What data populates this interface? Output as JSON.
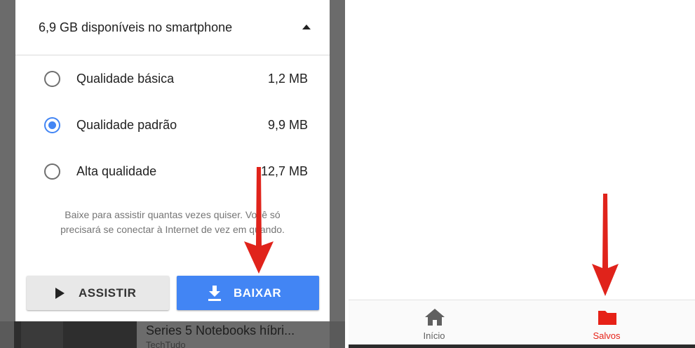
{
  "dialog": {
    "storage_text": "6,9 GB disponíveis no smartphone",
    "options": [
      {
        "label": "Qualidade básica",
        "size": "1,2 MB",
        "selected": false
      },
      {
        "label": "Qualidade padrão",
        "size": "9,9 MB",
        "selected": true
      },
      {
        "label": "Alta qualidade",
        "size": "12,7 MB",
        "selected": false
      }
    ],
    "description": "Baixe para assistir quantas vezes quiser. Você só precisará se conectar à Internet de vez em quando.",
    "assistir_label": "ASSISTIR",
    "baixar_label": "BAIXAR"
  },
  "background": {
    "video_title": "Series 5 Notebooks híbri...",
    "video_channel": "TechTudo"
  },
  "bottom_nav": {
    "items": [
      {
        "label": "Início",
        "icon": "home-icon",
        "active": false
      },
      {
        "label": "Salvos",
        "icon": "folder-icon",
        "active": true
      }
    ]
  },
  "colors": {
    "accent_blue": "#4285f4",
    "active_red": "#e62117",
    "arrow_red": "#e0231b"
  }
}
